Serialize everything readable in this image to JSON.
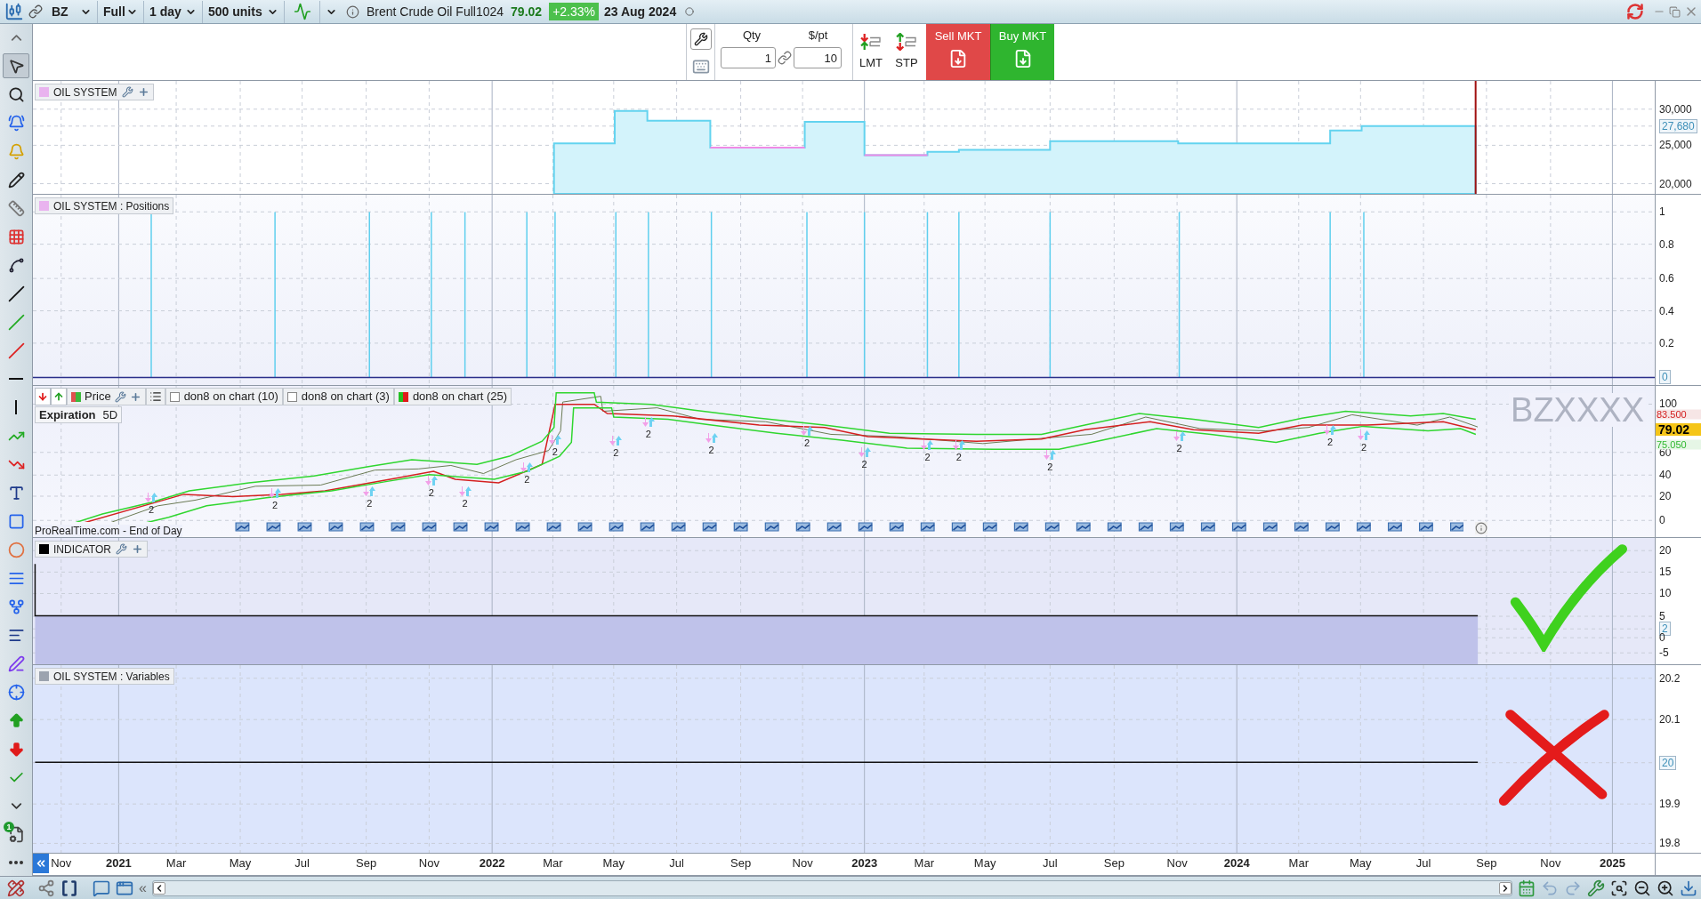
{
  "top_bar": {
    "symbol": "BZ",
    "mode": "Full",
    "interval": "1 day",
    "units": "500 units",
    "instrument": "Brent Crude Oil Full1024",
    "price": "79.02",
    "change": "+2.33%",
    "date": "23 Aug 2024"
  },
  "order_panel": {
    "qty_label": "Qty",
    "qty": "1",
    "point_label": "$/pt",
    "point_value": "10",
    "buttons": [
      {
        "kind": "limit",
        "label": "LMT"
      },
      {
        "kind": "stop",
        "label": "STP"
      },
      {
        "kind": "sell",
        "label": "Sell MKT"
      },
      {
        "kind": "buy",
        "label": "Buy MKT"
      }
    ]
  },
  "left_toolbar": {
    "badge": "1",
    "tools": [
      {
        "kind": "collapse",
        "selected": false
      },
      {
        "kind": "pointer",
        "selected": true
      },
      {
        "kind": "zoom",
        "selected": false
      },
      {
        "kind": "alert",
        "selected": false
      },
      {
        "kind": "bell",
        "selected": false
      },
      {
        "kind": "pencil",
        "selected": false
      },
      {
        "kind": "ruler",
        "selected": false
      },
      {
        "kind": "grid",
        "selected": false
      },
      {
        "kind": "segment",
        "selected": false
      },
      {
        "kind": "line",
        "selected": false
      },
      {
        "kind": "line-green",
        "selected": false
      },
      {
        "kind": "line-red",
        "selected": false
      },
      {
        "kind": "horizontal",
        "selected": false
      },
      {
        "kind": "vertical",
        "selected": false
      },
      {
        "kind": "channel",
        "selected": false
      },
      {
        "kind": "channel-red",
        "selected": false
      },
      {
        "kind": "text",
        "selected": false
      },
      {
        "kind": "rectangle",
        "selected": false
      },
      {
        "kind": "ellipse",
        "selected": false
      },
      {
        "kind": "fibonacci",
        "selected": false
      },
      {
        "kind": "pitchfork",
        "selected": false
      },
      {
        "kind": "fib-f",
        "selected": false
      },
      {
        "kind": "fib-g",
        "selected": false
      },
      {
        "kind": "cross",
        "selected": false
      },
      {
        "kind": "arrow-up",
        "selected": false
      },
      {
        "kind": "arrow-down",
        "selected": false
      },
      {
        "kind": "check",
        "selected": false
      },
      {
        "kind": "expand",
        "selected": false
      },
      {
        "kind": "strategy",
        "selected": false
      },
      {
        "kind": "more",
        "selected": false
      }
    ]
  },
  "equity_panel": {
    "legend": {
      "label": "OIL SYSTEM",
      "color": "#e9b3ef",
      "editable": true
    },
    "axis": [
      {
        "label": "30,000",
        "boxed": false
      },
      {
        "label": "27,680",
        "boxed": true
      },
      {
        "label": "25,000",
        "boxed": false
      },
      {
        "label": "20,000",
        "boxed": false
      }
    ]
  },
  "positions_panel": {
    "legend": {
      "label": "OIL SYSTEM : Positions",
      "color": "#e9b3ef",
      "editable": false
    },
    "axis": [
      {
        "label": "1",
        "boxed": false
      },
      {
        "label": "0.8",
        "boxed": false
      },
      {
        "label": "0.6",
        "boxed": false
      },
      {
        "label": "0.4",
        "boxed": false
      },
      {
        "label": "0.2",
        "boxed": false
      },
      {
        "label": "0",
        "boxed": true
      }
    ]
  },
  "price_panel": {
    "price_legend": "Price",
    "indicators": [
      {
        "label": "don8 on chart (10)",
        "kind": "empty"
      },
      {
        "label": "don8 on chart (3)",
        "kind": "empty"
      },
      {
        "label": "don8 on chart (25)",
        "kind": "red-green"
      }
    ],
    "expiration_label": "Expiration",
    "expiration_value": "5D",
    "watermark": "BZXXXX",
    "source": "ProRealTime.com - End of Day",
    "signal_labels": [
      "2",
      "2",
      "2",
      "2",
      "2",
      "2",
      "2",
      "2",
      "2",
      "2",
      "2",
      "2",
      "2",
      "2",
      "2",
      "2",
      "2",
      "2"
    ],
    "price_tags": [
      {
        "label": "83.500",
        "kind": "upper"
      },
      {
        "label": "79.02",
        "kind": "last"
      },
      {
        "label": "75.050",
        "kind": "lower"
      }
    ],
    "axis": [
      {
        "label": "100",
        "boxed": false
      },
      {
        "label": "60",
        "boxed": false
      },
      {
        "label": "40",
        "boxed": false
      },
      {
        "label": "20",
        "boxed": false
      },
      {
        "label": "0",
        "boxed": false
      }
    ]
  },
  "indicator_panel": {
    "legend": {
      "label": "INDICATOR",
      "color": "#000000",
      "editable": true
    },
    "axis": [
      {
        "label": "20",
        "boxed": false
      },
      {
        "label": "15",
        "boxed": false
      },
      {
        "label": "10",
        "boxed": false
      },
      {
        "label": "5",
        "boxed": false
      },
      {
        "label": "2",
        "boxed": true
      },
      {
        "label": "0",
        "boxed": false
      },
      {
        "label": "-5",
        "boxed": false
      }
    ]
  },
  "variables_panel": {
    "legend": {
      "label": "OIL SYSTEM : Variables",
      "color": "#9ca3af",
      "editable": false
    },
    "axis": [
      {
        "label": "20.2",
        "boxed": false
      },
      {
        "label": "20.1",
        "boxed": false
      },
      {
        "label": "20",
        "boxed": true
      },
      {
        "label": "19.9",
        "boxed": false
      },
      {
        "label": "19.8",
        "boxed": false
      }
    ]
  },
  "x_axis": {
    "labels": [
      {
        "label": "Nov",
        "kind": "month"
      },
      {
        "label": "2021",
        "kind": "year"
      },
      {
        "label": "Mar",
        "kind": "month"
      },
      {
        "label": "May",
        "kind": "month"
      },
      {
        "label": "Jul",
        "kind": "month"
      },
      {
        "label": "Sep",
        "kind": "month"
      },
      {
        "label": "Nov",
        "kind": "month"
      },
      {
        "label": "2022",
        "kind": "year"
      },
      {
        "label": "Mar",
        "kind": "month"
      },
      {
        "label": "May",
        "kind": "month"
      },
      {
        "label": "Jul",
        "kind": "month"
      },
      {
        "label": "Sep",
        "kind": "month"
      },
      {
        "label": "Nov",
        "kind": "month"
      },
      {
        "label": "2023",
        "kind": "year"
      },
      {
        "label": "Mar",
        "kind": "month"
      },
      {
        "label": "May",
        "kind": "month"
      },
      {
        "label": "Jul",
        "kind": "month"
      },
      {
        "label": "Sep",
        "kind": "month"
      },
      {
        "label": "Nov",
        "kind": "month"
      },
      {
        "label": "2024",
        "kind": "year"
      },
      {
        "label": "Mar",
        "kind": "month"
      },
      {
        "label": "May",
        "kind": "month"
      },
      {
        "label": "Jul",
        "kind": "month"
      },
      {
        "label": "Sep",
        "kind": "month"
      },
      {
        "label": "Nov",
        "kind": "month"
      },
      {
        "label": "2025",
        "kind": "year"
      }
    ]
  },
  "bottom_bar": {
    "collapse": "«"
  }
}
